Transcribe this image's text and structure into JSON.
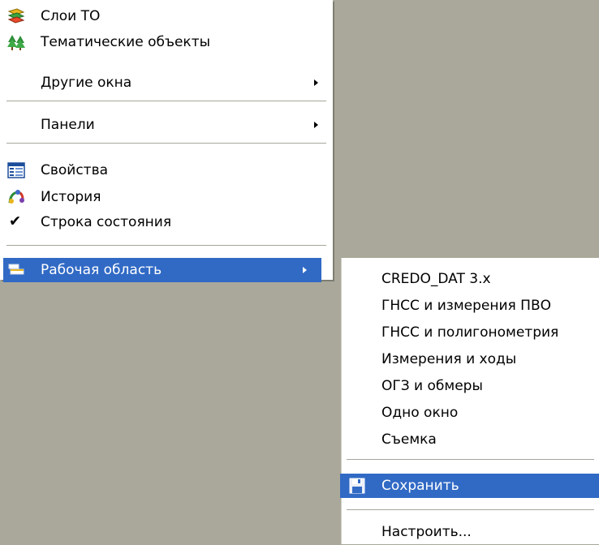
{
  "main_menu": {
    "items": [
      {
        "label": "Слои ТО",
        "icon": "layers-icon"
      },
      {
        "label": "Тематические объекты",
        "icon": "trees-icon"
      },
      {
        "label": "Другие окна",
        "submenu": true
      },
      {
        "label": "Панели",
        "submenu": true
      },
      {
        "label": "Свойства",
        "icon": "properties-icon"
      },
      {
        "label": "История",
        "icon": "history-icon"
      },
      {
        "label": "Строка состояния",
        "checked": true
      },
      {
        "label": "Рабочая область",
        "icon": "workspace-icon",
        "submenu": true,
        "selected": true
      }
    ]
  },
  "sub_menu": {
    "items": [
      {
        "label": "CREDO_DAT 3.x"
      },
      {
        "label": "ГНСС и измерения ПВО"
      },
      {
        "label": "ГНСС и полигонометрия"
      },
      {
        "label": "Измерения и ходы"
      },
      {
        "label": "ОГЗ и обмеры"
      },
      {
        "label": "Одно окно"
      },
      {
        "label": "Съемка"
      },
      {
        "label": "Сохранить",
        "icon": "save-icon",
        "selected": true
      },
      {
        "label": "Настроить..."
      }
    ]
  },
  "colors": {
    "highlight": "#316ac5",
    "desktop": "#a9a89a",
    "menu_bg": "#ffffff"
  }
}
